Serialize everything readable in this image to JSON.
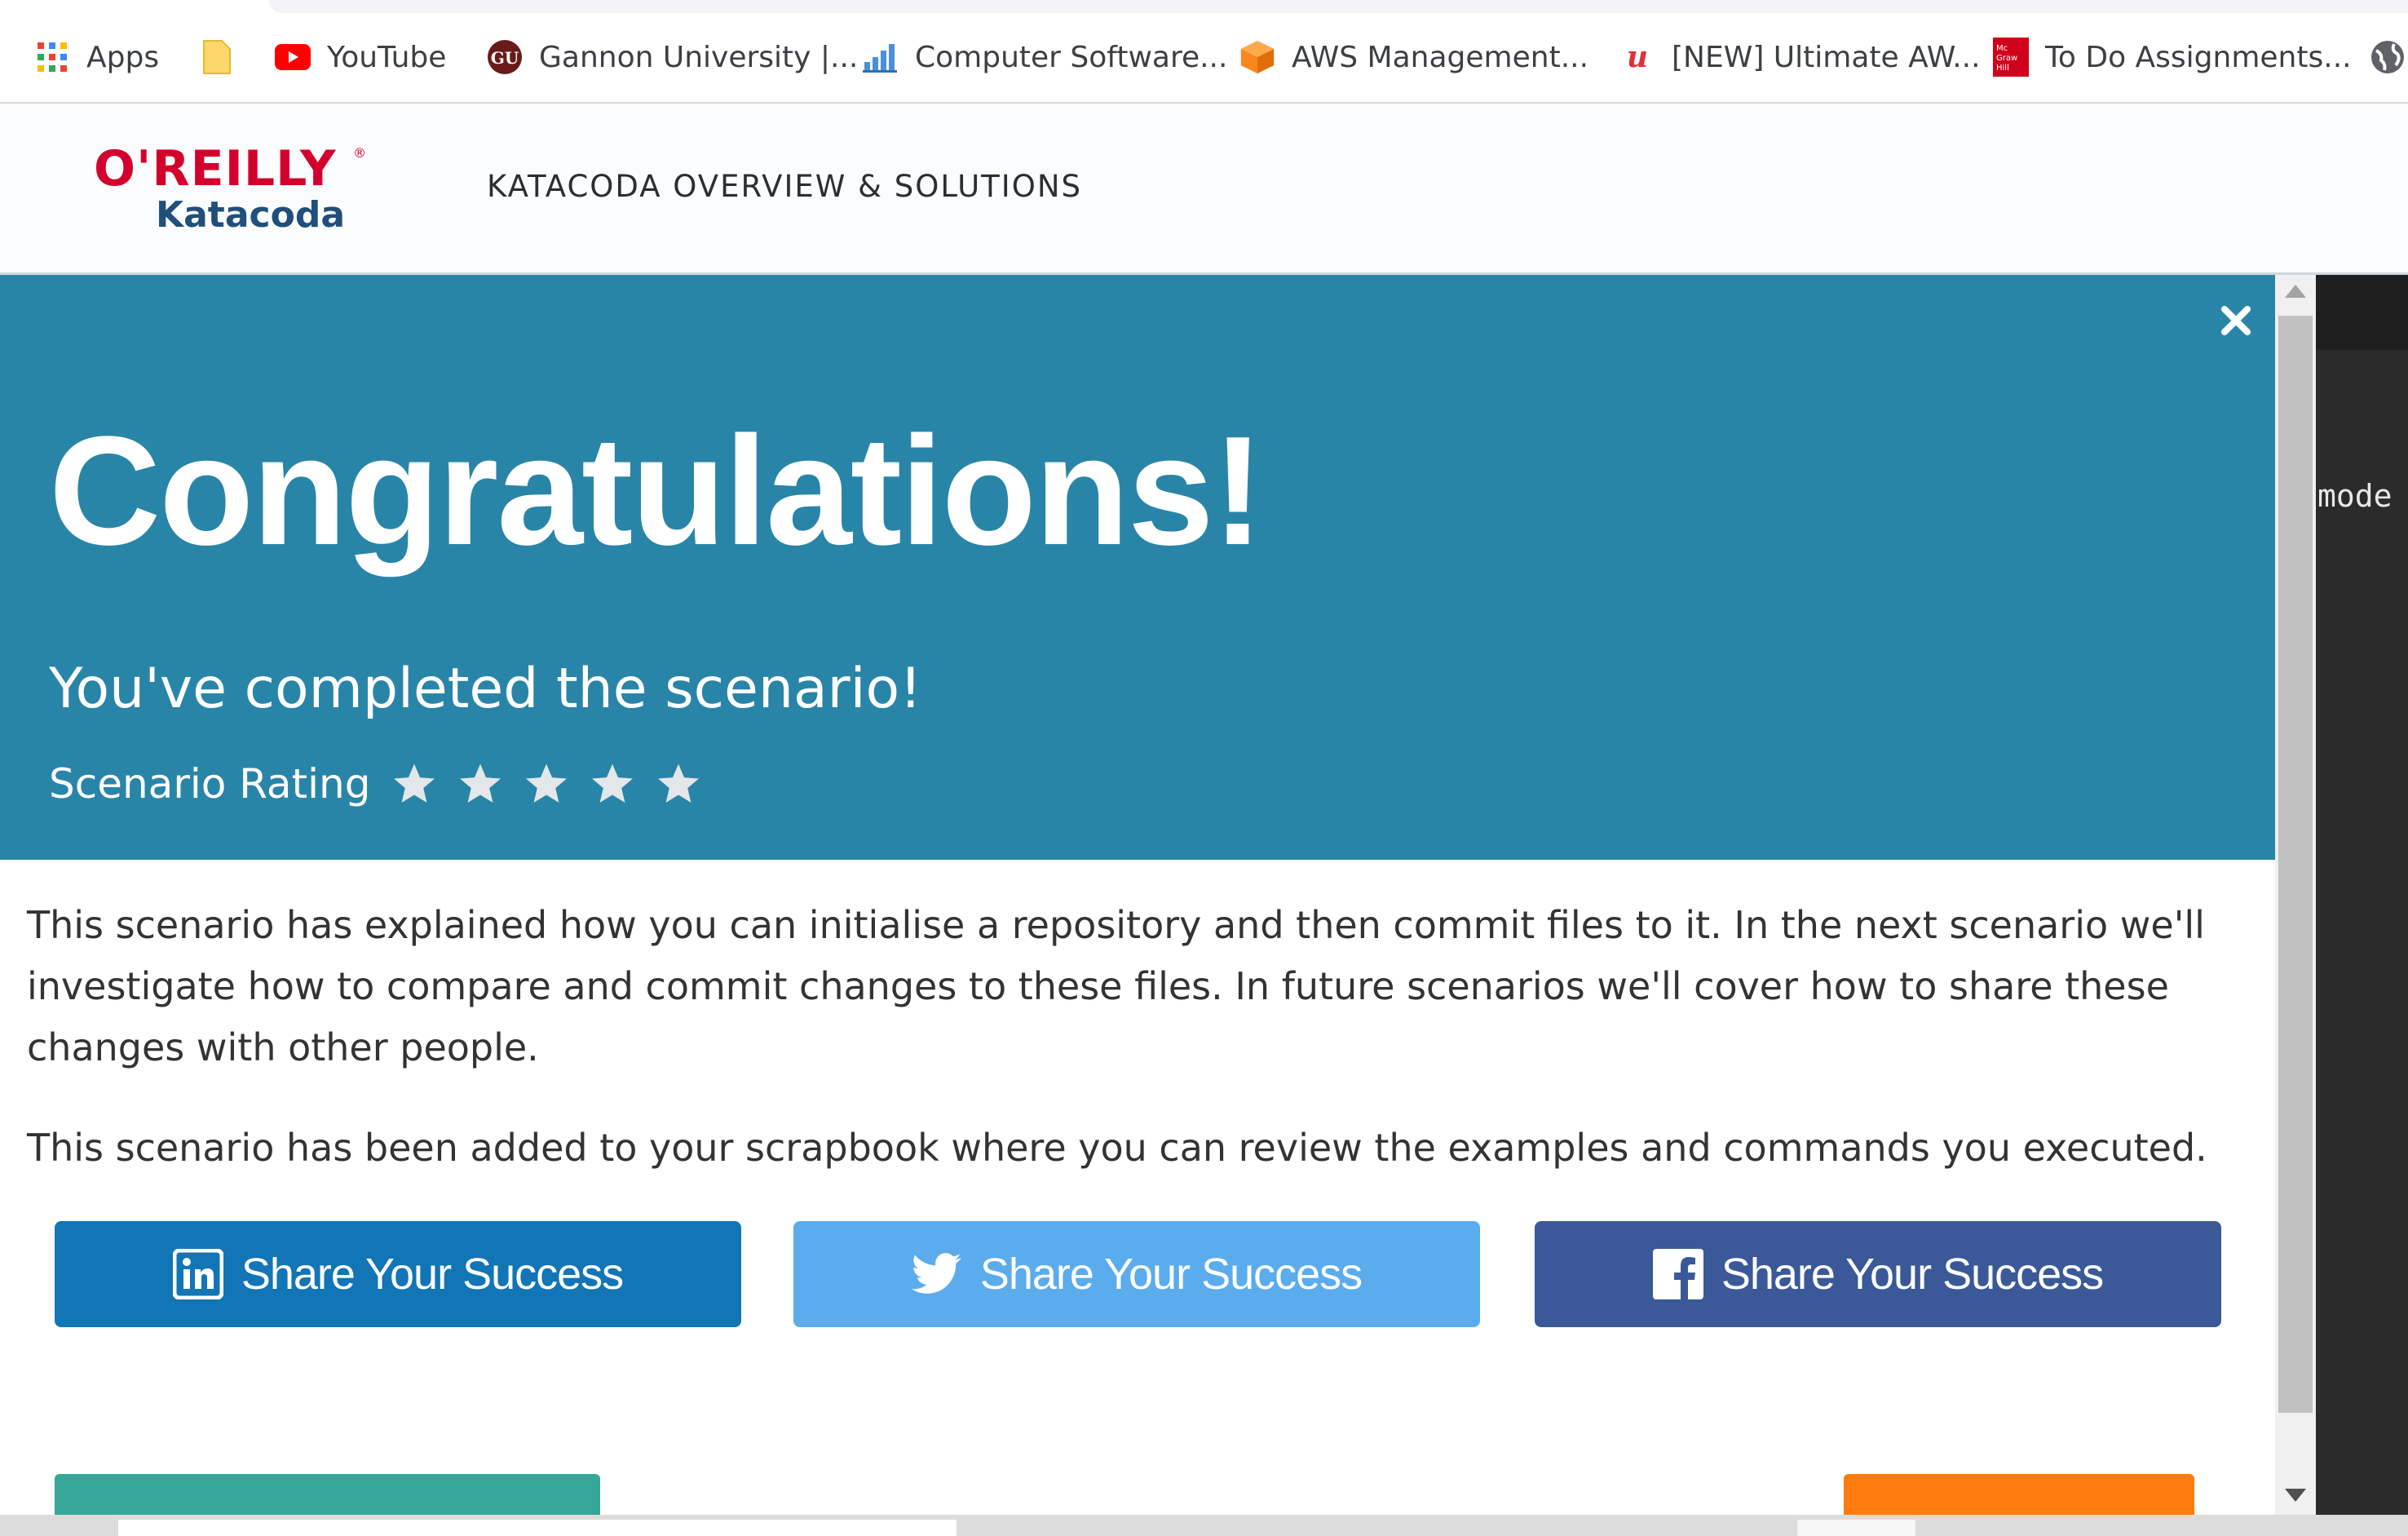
{
  "bookmarks": [
    {
      "label": "Apps",
      "icon": "apps-grid-icon"
    },
    {
      "label": "",
      "icon": "folder-icon"
    },
    {
      "label": "YouTube",
      "icon": "youtube-icon"
    },
    {
      "label": "Gannon University |...",
      "icon": "gannon-gu-icon",
      "icon_text": "GU"
    },
    {
      "label": "Computer Software...",
      "icon": "bar-chart-icon"
    },
    {
      "label": "AWS Management...",
      "icon": "aws-cube-icon"
    },
    {
      "label": "[NEW] Ultimate AW...",
      "icon": "udemy-icon",
      "icon_text": "u"
    },
    {
      "label": "To Do Assignments...",
      "icon": "mcgraw-hill-icon",
      "icon_text": "Mc Graw Hill"
    },
    {
      "label": "",
      "icon": "globe-icon"
    }
  ],
  "header": {
    "logo_top": "O'REILLY",
    "logo_bottom": "Katacoda",
    "nav_title": "KATACODA OVERVIEW & SOLUTIONS"
  },
  "modal": {
    "close_label": "×",
    "title": "Congratulations!",
    "subtitle": "You've completed the scenario!",
    "rating_label": "Scenario Rating",
    "rating_max": 5,
    "rating_value": 0,
    "paragraphs": [
      "This scenario has explained how you can initialise a repository and then commit files to it. In the next scenario we'll investigate how to compare and commit changes to these files. In future scenarios we'll cover how to share these changes with other people.",
      "This scenario has been added to your scrapbook where you can review the examples and commands you executed."
    ],
    "share_buttons": [
      {
        "label": "Share Your Success",
        "network": "linkedin",
        "color": "#1275b5"
      },
      {
        "label": "Share Your Success",
        "network": "twitter",
        "color": "#5aacec"
      },
      {
        "label": "Share Your Success",
        "network": "facebook",
        "color": "#3b5998"
      }
    ],
    "hero_color": "#2985a8"
  },
  "terminal": {
    "visible_text": "mode"
  },
  "colors": {
    "oreilly_red": "#d3002d",
    "katacoda_blue": "#1f4f7a",
    "teal_button": "#37a799",
    "orange_button": "#fd7b0f"
  }
}
